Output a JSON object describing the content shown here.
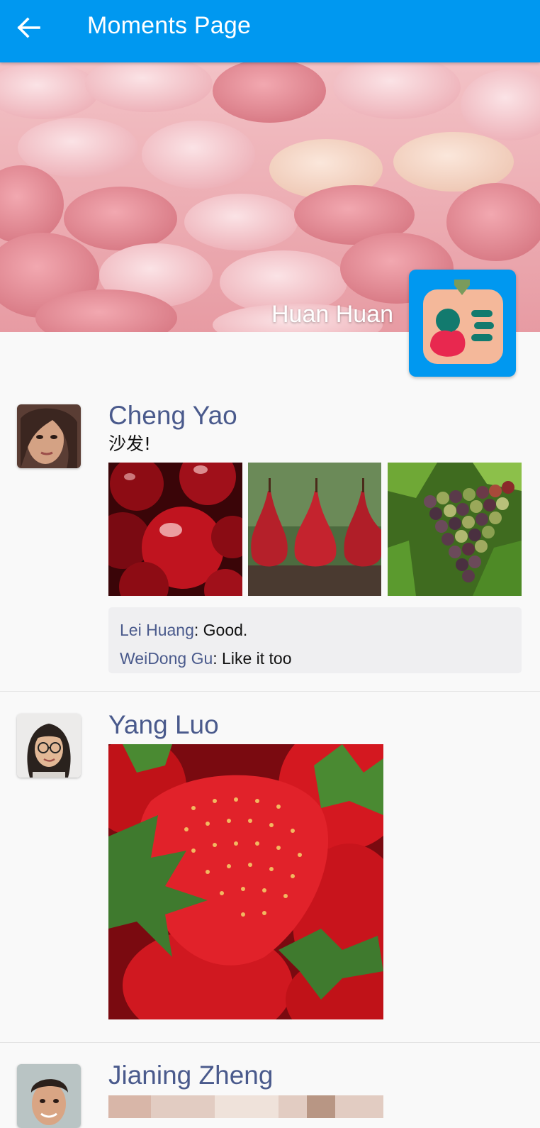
{
  "app_bar": {
    "title": "Moments Page",
    "back_icon": "arrow-back-icon",
    "background": "#0098f0"
  },
  "cover": {
    "user_name": "Huan Huan",
    "avatar_icon": "app-logo-icon"
  },
  "posts": [
    {
      "author": "Cheng Yao",
      "content": "沙发!",
      "photos": [
        "cherries",
        "red-pears",
        "grapes"
      ],
      "comments": [
        {
          "author": "Lei Huang",
          "separator": ": ",
          "text": "Good."
        },
        {
          "author": "WeiDong Gu",
          "separator": ": ",
          "text": "Like it too"
        }
      ]
    },
    {
      "author": "Yang Luo",
      "content": "",
      "photos": [
        "strawberries"
      ],
      "comments": []
    },
    {
      "author": "Jianing Zheng",
      "content": "",
      "photos": [
        "photo"
      ],
      "comments": []
    }
  ],
  "colors": {
    "accent": "#0098f0",
    "name_color": "#4a5a8c",
    "comment_bg": "#efeff1"
  }
}
